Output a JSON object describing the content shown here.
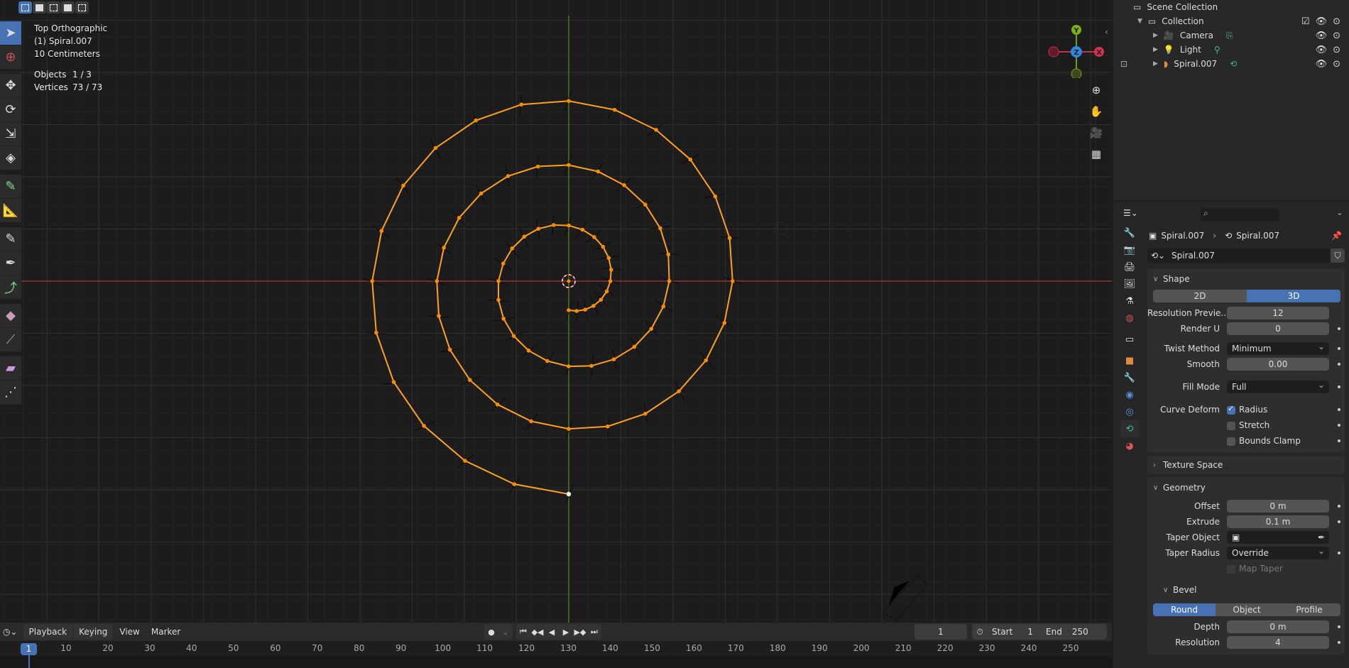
{
  "header": {
    "select_modes": [
      "set",
      "extend",
      "subtract",
      "difference",
      "intersect"
    ]
  },
  "viewport": {
    "view_name": "Top Orthographic",
    "object_label": "(1) Spiral.007",
    "grid_scale": "10 Centimeters",
    "stats": [
      {
        "label": "Objects",
        "value": "1 / 3"
      },
      {
        "label": "Vertices",
        "value": "73 / 73"
      }
    ],
    "gizmo": {
      "x": "X",
      "y": "Y",
      "z": "Z"
    },
    "spiral": {
      "point_count": 73,
      "turns": 3,
      "color": "#ffa020",
      "endpoint_color": "#ffffff"
    }
  },
  "toolbar": {
    "tools": [
      "select-box",
      "cursor",
      "move",
      "rotate",
      "scale",
      "transform",
      "annotate",
      "measure",
      "draw",
      "pen",
      "curve-extrude",
      "radius",
      "tilt",
      "extrude",
      "randomize"
    ]
  },
  "outliner": {
    "scene_collection": "Scene Collection",
    "collection": "Collection",
    "items": [
      {
        "name": "Camera",
        "type": "camera"
      },
      {
        "name": "Light",
        "type": "light"
      },
      {
        "name": "Spiral.007",
        "type": "curve"
      }
    ]
  },
  "properties": {
    "search_placeholder": "",
    "breadcrumb": {
      "object": "Spiral.007",
      "data": "Spiral.007"
    },
    "datablock_name": "Spiral.007",
    "shape": {
      "title": "Shape",
      "dim_options": [
        "2D",
        "3D"
      ],
      "dim_selected": "3D",
      "resolution_preview_label": "Resolution Previe...",
      "resolution_preview": "12",
      "render_u_label": "Render U",
      "render_u": "0",
      "twist_method_label": "Twist Method",
      "twist_method": "Minimum",
      "smooth_label": "Smooth",
      "smooth": "0.00",
      "fill_mode_label": "Fill Mode",
      "fill_mode": "Full",
      "curve_deform_label": "Curve Deform",
      "radius_label": "Radius",
      "radius_checked": true,
      "stretch_label": "Stretch",
      "stretch_checked": false,
      "bounds_clamp_label": "Bounds Clamp",
      "bounds_clamp_checked": false
    },
    "texture_space": {
      "title": "Texture Space"
    },
    "geometry": {
      "title": "Geometry",
      "offset_label": "Offset",
      "offset": "0 m",
      "extrude_label": "Extrude",
      "extrude": "0.1 m",
      "taper_object_label": "Taper Object",
      "taper_radius_label": "Taper Radius",
      "taper_radius": "Override",
      "map_taper_label": "Map Taper"
    },
    "bevel": {
      "title": "Bevel",
      "modes": [
        "Round",
        "Object",
        "Profile"
      ],
      "mode_selected": "Round",
      "depth_label": "Depth",
      "depth": "0 m",
      "resolution_label": "Resolution",
      "resolution": "4"
    }
  },
  "timeline": {
    "menus": [
      "Playback",
      "Keying",
      "View",
      "Marker"
    ],
    "current_frame": "1",
    "start_label": "Start",
    "start": "1",
    "end_label": "End",
    "end": "250",
    "ticks": [
      "10",
      "20",
      "30",
      "40",
      "50",
      "60",
      "70",
      "80",
      "90",
      "100",
      "110",
      "120",
      "130",
      "140",
      "150",
      "160",
      "170",
      "180",
      "190",
      "200",
      "210",
      "220",
      "230",
      "240",
      "250"
    ],
    "playhead": "1"
  }
}
